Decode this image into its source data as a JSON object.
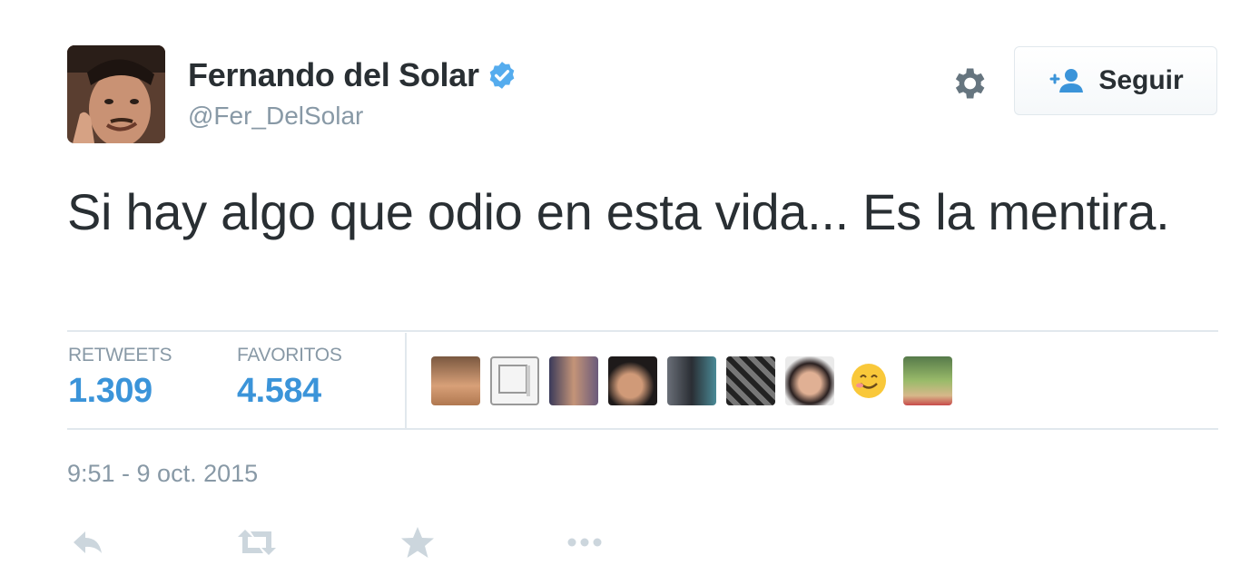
{
  "user": {
    "display_name": "Fernando del Solar",
    "handle": "@Fer_DelSolar",
    "verified": true,
    "avatar_icon": "profile-photo"
  },
  "follow_button": {
    "label": "Seguir",
    "icon": "add-user-icon"
  },
  "settings_icon": "gear-icon",
  "tweet": {
    "text": "Si hay algo que odio en esta vida... Es la mentira."
  },
  "stats": {
    "retweets": {
      "label": "RETWEETS",
      "value": "1.309"
    },
    "favorites": {
      "label": "FAVORITOS",
      "value": "4.584"
    }
  },
  "favorited_by_avatars": [
    "avatar-1",
    "avatar-2",
    "avatar-3",
    "avatar-4",
    "avatar-5",
    "avatar-6",
    "avatar-7",
    "avatar-8",
    "avatar-9"
  ],
  "timestamp": "9:51 - 9 oct. 2015",
  "actions": [
    "reply-icon",
    "retweet-icon",
    "favorite-icon",
    "more-icon"
  ],
  "colors": {
    "link_blue": "#3b94d9",
    "muted": "#8899a6",
    "text": "#292f33",
    "verified_blue": "#55acee"
  }
}
